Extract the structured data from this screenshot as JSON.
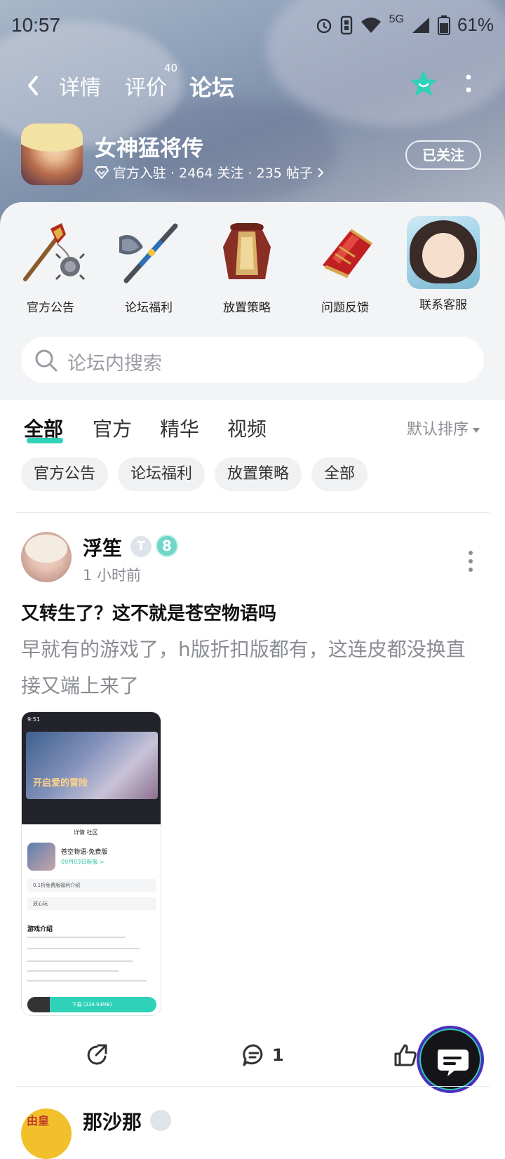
{
  "status_bar": {
    "time": "10:57",
    "network": "5G",
    "battery": "61%"
  },
  "topnav": {
    "tabs": [
      {
        "label": "详情"
      },
      {
        "label": "评价",
        "badge": "40"
      },
      {
        "label": "论坛"
      }
    ],
    "active_tab": "论坛",
    "accent_color": "#2fd1b8"
  },
  "game": {
    "title": "女神猛将传",
    "meta": "官方入驻 · 2464 关注 · 235 帖子",
    "follow_label": "已关注"
  },
  "categories": [
    {
      "label": "官方公告",
      "icon": "mace-icon"
    },
    {
      "label": "论坛福利",
      "icon": "halberd-icon"
    },
    {
      "label": "放置策略",
      "icon": "armor-icon"
    },
    {
      "label": "问题反馈",
      "icon": "gauntlet-icon"
    },
    {
      "label": "联系客服",
      "icon": "character-avatar"
    }
  ],
  "search": {
    "placeholder": "论坛内搜索"
  },
  "filters": {
    "tabs": [
      {
        "label": "全部",
        "active": true
      },
      {
        "label": "官方"
      },
      {
        "label": "精华"
      },
      {
        "label": "视频"
      }
    ],
    "sort_label": "默认排序",
    "chips": [
      "官方公告",
      "论坛福利",
      "放置策略",
      "全部"
    ]
  },
  "post": {
    "author": "浮笙",
    "badge_t": "T",
    "level": "8",
    "time": "1 小时前",
    "title": "又转生了？这不就是苍空物语吗",
    "body": "早就有的游戏了，h版折扣版都有，这连皮都没换直接又端上来了",
    "image": {
      "status_time": "9:51",
      "banner_text": "开启爱的冒险",
      "tabs": "详情  社区",
      "app_name": "苍空物语-免费版",
      "app_sub": "09月03日新服 >",
      "row1": "0.1折免费版福利介绍",
      "row2": "放心玩",
      "section": "游戏介绍",
      "download": "下载 (239.93MB)"
    },
    "comment_count": "1"
  },
  "next_post": {
    "author": "那沙那",
    "avatar_text": "由皇"
  }
}
